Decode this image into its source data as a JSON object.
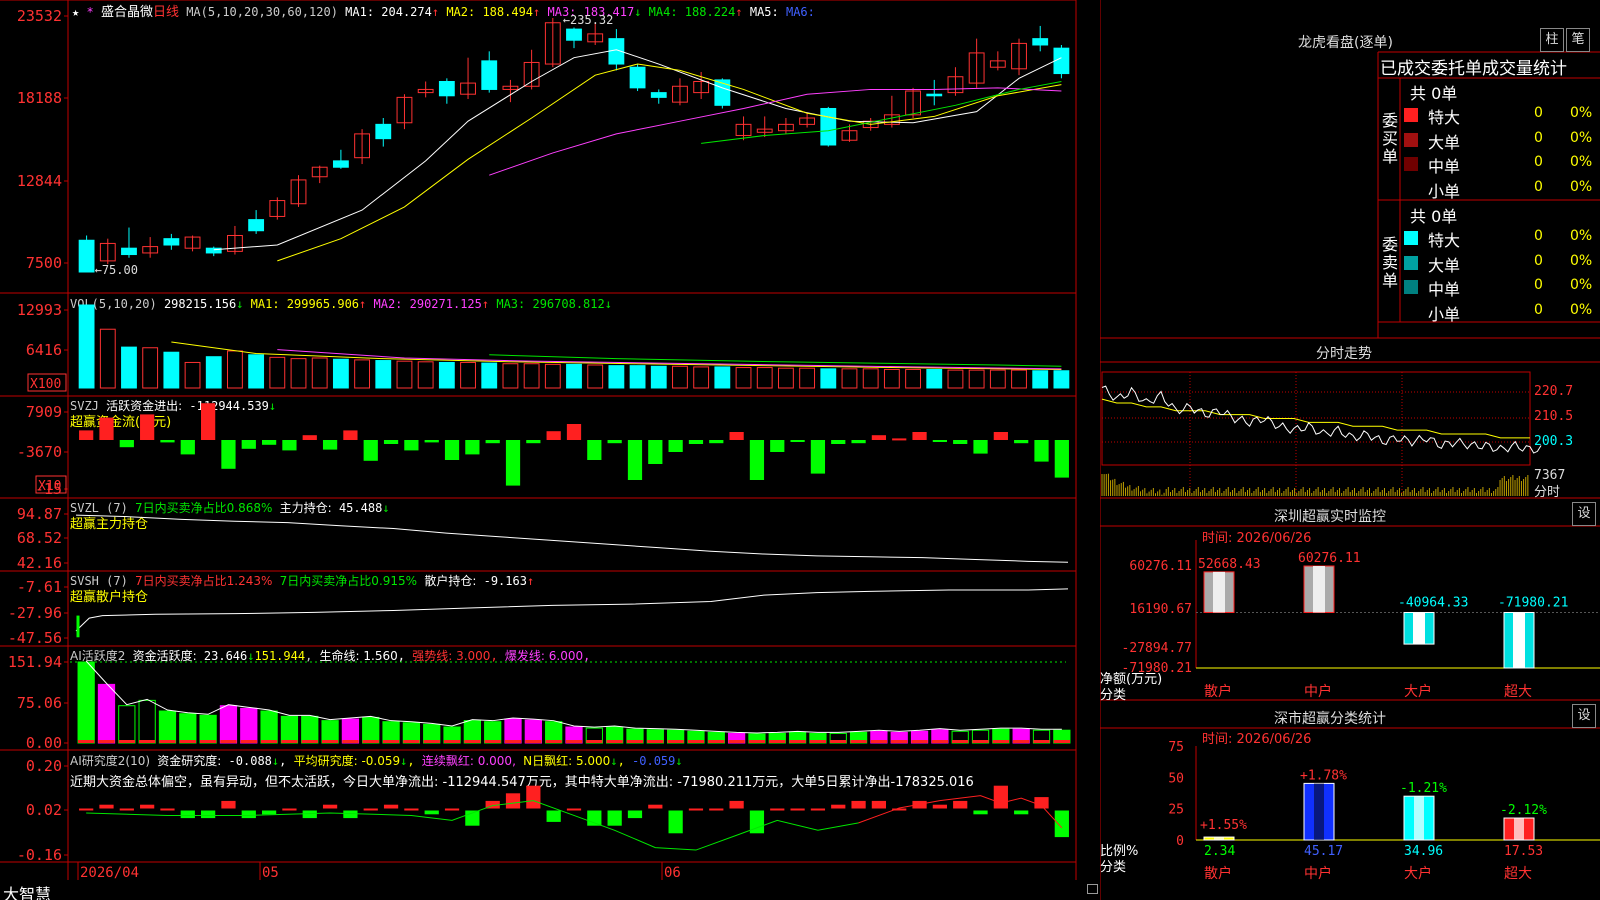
{
  "colors": {
    "up": "#ff3232",
    "down": "#00ffff",
    "grid": "#c00000",
    "ma1": "#ffffff",
    "ma2": "#ffff00",
    "ma3": "#ff40ff",
    "ma4": "#00e600",
    "ma5": "#4060ff",
    "vgreen": "#00ff00",
    "vmag": "#ff00ff"
  },
  "app": {
    "brand": "大智慧",
    "lock_icon": "lock-icon"
  },
  "kline": {
    "title_prefix": "★",
    "stock_name": "盛合晶微",
    "period": "日线",
    "ma_def": "MA(5,10,20,30,60,120)",
    "ma1": "MA1: 204.274",
    "ma1_arrow": "↑",
    "ma2": "MA2: 188.494",
    "ma2_arrow": "↑",
    "ma3": "MA3: 183.417",
    "ma3_arrow": "↓",
    "ma4": "MA4: 188.224",
    "ma4_arrow": "↑",
    "ma5": "MA5:",
    "ma6": "MA6:",
    "high_label": "235.32",
    "low_label": "75.00",
    "y_labels": [
      "23532",
      "18188",
      "12844",
      "7500"
    ]
  },
  "candles": [
    [
      95,
      75,
      98,
      75
    ],
    [
      82,
      93,
      96,
      80
    ],
    [
      90,
      86,
      103,
      84
    ],
    [
      87,
      91,
      97,
      84
    ],
    [
      96,
      92,
      99,
      89
    ],
    [
      90,
      97,
      98,
      88
    ],
    [
      90,
      87,
      91,
      85
    ],
    [
      88,
      98,
      104,
      86
    ],
    [
      108,
      101,
      114,
      99
    ],
    [
      110,
      120,
      122,
      108
    ],
    [
      118,
      133,
      136,
      116
    ],
    [
      135,
      141,
      142,
      131
    ],
    [
      145,
      141,
      152,
      140
    ],
    [
      147,
      162,
      165,
      143
    ],
    [
      168,
      159,
      172,
      154
    ],
    [
      169,
      185,
      187,
      165
    ],
    [
      188,
      190,
      195,
      185
    ],
    [
      195,
      186,
      197,
      181
    ],
    [
      187,
      194,
      210,
      184
    ],
    [
      208,
      190,
      214,
      188
    ],
    [
      190,
      192,
      196,
      182
    ],
    [
      192,
      207,
      215,
      190
    ],
    [
      206,
      232,
      235,
      204
    ],
    [
      228,
      221,
      229,
      216
    ],
    [
      220,
      225,
      232,
      218
    ],
    [
      222,
      206,
      228,
      202
    ],
    [
      204,
      191,
      206,
      189
    ],
    [
      188,
      185,
      190,
      181
    ],
    [
      182,
      192,
      197,
      180
    ],
    [
      188,
      195,
      201,
      184
    ],
    [
      196,
      180,
      197,
      178
    ],
    [
      161,
      168,
      173,
      158
    ],
    [
      163,
      165,
      173,
      160
    ],
    [
      164,
      168,
      172,
      162
    ],
    [
      168,
      172,
      175,
      166
    ],
    [
      178,
      155,
      179,
      154
    ],
    [
      158,
      164,
      168,
      157
    ],
    [
      166,
      170,
      172,
      164
    ],
    [
      168,
      174,
      186,
      166
    ],
    [
      174,
      189,
      191,
      172
    ],
    [
      187,
      186,
      196,
      180
    ],
    [
      188,
      198,
      204,
      186
    ],
    [
      194,
      213,
      222,
      191
    ],
    [
      204,
      208,
      214,
      202
    ],
    [
      203,
      219,
      222,
      199
    ],
    [
      222,
      218,
      230,
      214
    ],
    [
      216,
      200,
      218,
      197
    ]
  ],
  "ma_lines": {
    "white": [
      [
        6,
        89
      ],
      [
        9,
        92
      ],
      [
        13,
        114
      ],
      [
        16,
        145
      ],
      [
        18,
        170
      ],
      [
        21,
        195
      ],
      [
        23,
        210
      ],
      [
        25,
        215
      ],
      [
        27,
        206
      ],
      [
        30,
        191
      ],
      [
        33,
        178
      ],
      [
        36,
        170
      ],
      [
        39,
        169
      ],
      [
        42,
        176
      ],
      [
        44,
        197
      ],
      [
        46,
        210
      ]
    ],
    "yellow": [
      [
        9,
        82
      ],
      [
        12,
        96
      ],
      [
        15,
        116
      ],
      [
        18,
        146
      ],
      [
        21,
        172
      ],
      [
        24,
        199
      ],
      [
        26,
        206
      ],
      [
        28,
        202
      ],
      [
        31,
        190
      ],
      [
        34,
        175
      ],
      [
        37,
        168
      ],
      [
        40,
        173
      ],
      [
        43,
        186
      ],
      [
        46,
        193
      ]
    ],
    "magenta": [
      [
        19,
        136
      ],
      [
        22,
        150
      ],
      [
        25,
        162
      ],
      [
        28,
        170
      ],
      [
        31,
        178
      ],
      [
        34,
        187
      ],
      [
        37,
        190
      ],
      [
        40,
        190
      ],
      [
        43,
        191
      ],
      [
        46,
        189
      ]
    ],
    "green": [
      [
        29,
        156
      ],
      [
        32,
        161
      ],
      [
        35,
        164
      ],
      [
        38,
        172
      ],
      [
        41,
        180
      ],
      [
        44,
        190
      ],
      [
        46,
        195
      ]
    ]
  },
  "vol": {
    "title": "VOL(5,10,20)",
    "value": "298215.156",
    "value_arrow": "↓",
    "ma1": "MA1: 299965.906",
    "ma1_arrow": "↑",
    "ma2": "MA2: 290271.125",
    "ma2_arrow": "↑",
    "ma3": "MA3: 296708.812",
    "ma3_arrow": "↓",
    "y_labels": [
      "12993",
      "6416",
      "X100"
    ],
    "values": [
      12993,
      9200,
      6400,
      6300,
      5600,
      4000,
      4900,
      5800,
      5200,
      4800,
      4600,
      4700,
      4500,
      4400,
      4300,
      4200,
      4100,
      4000,
      4000,
      3900,
      3800,
      3800,
      3700,
      3700,
      3600,
      3500,
      3500,
      3400,
      3400,
      3300,
      3300,
      3200,
      3200,
      3100,
      3100,
      3000,
      3000,
      3000,
      2900,
      2900,
      2900,
      2800,
      2800,
      2800,
      2800,
      2700,
      2700
    ],
    "ma_yellow": [
      [
        4,
        7200
      ],
      [
        8,
        5400
      ],
      [
        14,
        4600
      ],
      [
        20,
        4100
      ],
      [
        26,
        3800
      ],
      [
        32,
        3500
      ],
      [
        38,
        3200
      ],
      [
        46,
        2900
      ]
    ],
    "ma_magenta": [
      [
        9,
        6000
      ],
      [
        15,
        4700
      ],
      [
        21,
        4200
      ],
      [
        27,
        3900
      ],
      [
        33,
        3600
      ],
      [
        39,
        3300
      ],
      [
        46,
        3000
      ]
    ],
    "ma_green": [
      [
        19,
        5200
      ],
      [
        25,
        4600
      ],
      [
        31,
        4200
      ],
      [
        37,
        3900
      ],
      [
        43,
        3600
      ],
      [
        46,
        3400
      ]
    ]
  },
  "svzj": {
    "title": "SVZJ",
    "label": "活跃资金进出:",
    "value": "-112944.539",
    "value_arrow": "↓",
    "subtitle": "超赢资金流(万元)",
    "y_labels": [
      "7909",
      "-3670",
      "-15",
      "X10"
    ],
    "values": [
      1200,
      2800,
      -900,
      3200,
      -300,
      -1800,
      4600,
      -3600,
      -1100,
      -600,
      -1300,
      600,
      -1200,
      1200,
      -2600,
      -500,
      -1300,
      -300,
      -2500,
      -1800,
      -400,
      -5700,
      -400,
      1100,
      2000,
      -2500,
      -400,
      -5000,
      -3000,
      -1500,
      -500,
      -400,
      1000,
      -5000,
      -1500,
      -200,
      -4200,
      -500,
      -400,
      600,
      200,
      1000,
      -200,
      -500,
      -1700,
      1000,
      -400,
      -2700,
      -4700
    ]
  },
  "svzl": {
    "title": "SVZL (7)",
    "d1": "7日内买卖净占比0.868%",
    "label": "主力持仓:",
    "value": "45.488",
    "value_arrow": "↓",
    "subtitle": "超赢主力持仓",
    "y_labels": [
      "94.87",
      "68.52",
      "42.16"
    ],
    "line": [
      [
        0,
        94.8
      ],
      [
        4,
        93
      ],
      [
        8,
        90
      ],
      [
        12,
        88
      ],
      [
        16,
        86.5
      ],
      [
        20,
        83
      ],
      [
        24,
        80
      ],
      [
        28,
        75
      ],
      [
        32,
        71
      ],
      [
        36,
        67
      ],
      [
        40,
        63
      ],
      [
        44,
        59
      ],
      [
        48,
        55
      ],
      [
        52,
        52
      ],
      [
        56,
        50
      ],
      [
        60,
        49
      ],
      [
        64,
        48
      ],
      [
        68,
        46
      ],
      [
        72,
        44
      ],
      [
        75,
        43
      ]
    ]
  },
  "svsh": {
    "title": "SVSH (7)",
    "d1": "7日内买卖净占比1.243%",
    "d2": "7日内买卖净占比0.915%",
    "label": "散户持仓:",
    "value": "-9.163",
    "value_arrow": "↑",
    "subtitle": "超赢散户持仓",
    "y_labels": [
      "-7.61",
      "-27.96",
      "-47.56"
    ],
    "line": [
      [
        0,
        -42
      ],
      [
        1,
        -32
      ],
      [
        2,
        -30
      ],
      [
        6,
        -29
      ],
      [
        12,
        -28.5
      ],
      [
        18,
        -27.5
      ],
      [
        24,
        -26
      ],
      [
        30,
        -24
      ],
      [
        36,
        -22
      ],
      [
        42,
        -21
      ],
      [
        48,
        -19
      ],
      [
        52,
        -14
      ],
      [
        56,
        -12
      ],
      [
        60,
        -11
      ],
      [
        66,
        -10
      ],
      [
        72,
        -10
      ],
      [
        75,
        -9.1
      ]
    ]
  },
  "ai_active": {
    "title": "AI活跃度2",
    "label": "资金活跃度:",
    "value": "23.646",
    "value_arrow": "↓",
    "v2": "151.944",
    "life": "生命线: 1.560",
    "strong": "强势线: 3.000",
    "burst": "爆发线: 6.000",
    "y_labels": [
      "151.94",
      "75.06",
      "0.00"
    ],
    "values": [
      [
        152,
        "g"
      ],
      [
        110,
        "m"
      ],
      [
        70,
        "o"
      ],
      [
        80,
        "o"
      ],
      [
        60,
        "g"
      ],
      [
        55,
        "g"
      ],
      [
        52,
        "g"
      ],
      [
        70,
        "m"
      ],
      [
        65,
        "m"
      ],
      [
        60,
        "g"
      ],
      [
        50,
        "g"
      ],
      [
        50,
        "g"
      ],
      [
        42,
        "g"
      ],
      [
        45,
        "m"
      ],
      [
        48,
        "g"
      ],
      [
        40,
        "g"
      ],
      [
        38,
        "g"
      ],
      [
        35,
        "g"
      ],
      [
        30,
        "g"
      ],
      [
        42,
        "g"
      ],
      [
        40,
        "g"
      ],
      [
        45,
        "m"
      ],
      [
        43,
        "m"
      ],
      [
        40,
        "g"
      ],
      [
        30,
        "m"
      ],
      [
        28,
        "o"
      ],
      [
        30,
        "g"
      ],
      [
        26,
        "g"
      ],
      [
        25,
        "g"
      ],
      [
        24,
        "g"
      ],
      [
        22,
        "g"
      ],
      [
        20,
        "g"
      ],
      [
        18,
        "m"
      ],
      [
        17,
        "g"
      ],
      [
        18,
        "g"
      ],
      [
        20,
        "g"
      ],
      [
        18,
        "g"
      ],
      [
        18,
        "o"
      ],
      [
        20,
        "g"
      ],
      [
        22,
        "m"
      ],
      [
        20,
        "m"
      ],
      [
        22,
        "m"
      ],
      [
        25,
        "m"
      ],
      [
        22,
        "o"
      ],
      [
        24,
        "o"
      ],
      [
        26,
        "g"
      ],
      [
        26,
        "m"
      ],
      [
        24,
        "o"
      ],
      [
        24,
        "g"
      ]
    ]
  },
  "ai_research": {
    "title": "AI研究度2(10)",
    "label": "资金研究度:",
    "value": "-0.088",
    "value_arrow": "↓",
    "avg": "平均研究度: -0.059",
    "avg_arrow": "↓",
    "cont": "连续飘红: 0.000,",
    "nday": "N日飘红: 5.000",
    "nday_arrow": "↓",
    "last": "-0.059",
    "last_arrow": "↓",
    "note": "近期大资金总体偏空，虽有异动，但不太活跃，今日大单净流出: -112944.547万元，其中特大单净流出: -71980.211万元，大单5日累计净出-178325.016",
    "y_labels": [
      "0.20",
      "0.02",
      "-0.16"
    ],
    "values": [
      0.0,
      0.01,
      0.0,
      0.01,
      0.0,
      -0.02,
      -0.02,
      0.02,
      -0.02,
      -0.01,
      0.0,
      -0.02,
      0.01,
      -0.02,
      0.0,
      0.01,
      0.0,
      -0.01,
      0.0,
      -0.04,
      0.02,
      0.04,
      0.06,
      -0.03,
      0.0,
      -0.04,
      -0.04,
      -0.02,
      0.01,
      -0.06,
      0.0,
      0.0,
      0.02,
      -0.06,
      0.0,
      0.0,
      0.0,
      0.01,
      0.02,
      0.02,
      0.0,
      0.02,
      0.01,
      0.02,
      -0.01,
      0.06,
      -0.01,
      0.03,
      -0.07
    ],
    "line": [
      [
        0,
        0.01
      ],
      [
        4,
        0.0
      ],
      [
        8,
        0.0
      ],
      [
        12,
        0.01
      ],
      [
        16,
        0.0
      ],
      [
        18,
        -0.02
      ],
      [
        20,
        0.04
      ],
      [
        22,
        0.06
      ],
      [
        24,
        0.0
      ],
      [
        26,
        -0.06
      ],
      [
        28,
        -0.13
      ],
      [
        30,
        -0.14
      ],
      [
        32,
        -0.08
      ],
      [
        34,
        -0.02
      ],
      [
        36,
        -0.06
      ],
      [
        38,
        -0.03
      ],
      [
        40,
        0.03
      ],
      [
        42,
        0.06
      ],
      [
        44,
        0.08
      ],
      [
        45,
        0.05
      ],
      [
        46,
        0.07
      ],
      [
        47,
        0.04
      ],
      [
        48,
        -0.05
      ]
    ]
  },
  "xaxis": {
    "labels": [
      "2026/04",
      "05",
      "06"
    ]
  },
  "lhb": {
    "title": "龙虎看盘(逐单)",
    "btn1": "柱",
    "btn2": "笔",
    "header": "已成交委托单成交量统计",
    "buy_total": "共 0单",
    "buy_side": "委买单",
    "sell_total": "共 0单",
    "sell_side": "委卖单",
    "buy_rows": [
      {
        "label": "特大",
        "color": "#ff2020",
        "qty": "0",
        "pct": "0%"
      },
      {
        "label": "大单",
        "color": "#a01010",
        "qty": "0",
        "pct": "0%"
      },
      {
        "label": "中单",
        "color": "#700000",
        "qty": "0",
        "pct": "0%"
      },
      {
        "label": "小单",
        "color": "",
        "qty": "0",
        "pct": "0%"
      }
    ],
    "sell_rows": [
      {
        "label": "特大",
        "color": "#00ffff",
        "qty": "0",
        "pct": "0%"
      },
      {
        "label": "大单",
        "color": "#00a0a0",
        "qty": "0",
        "pct": "0%"
      },
      {
        "label": "中单",
        "color": "#008080",
        "qty": "0",
        "pct": "0%"
      },
      {
        "label": "小单",
        "color": "",
        "qty": "0",
        "pct": "0%"
      }
    ]
  },
  "fenshi": {
    "title": "分时走势",
    "right_labels": [
      "220.7",
      "210.5",
      "200.3",
      "7367",
      "分时"
    ],
    "price": [
      206,
      203,
      205,
      202,
      204,
      200,
      201,
      199,
      200,
      198,
      197,
      198,
      196,
      195,
      196,
      194,
      195,
      193,
      194,
      192,
      193,
      192,
      193,
      191,
      192,
      191,
      191,
      190,
      191,
      190
    ],
    "avg": [
      203,
      202,
      202,
      201,
      201,
      200,
      200,
      200,
      199,
      199,
      199,
      198,
      198,
      198,
      197,
      197,
      197,
      196,
      196,
      196,
      195,
      195,
      195,
      194,
      194,
      194,
      194,
      193,
      193,
      193
    ]
  },
  "sz_monitor": {
    "title": "深圳超赢实时监控",
    "btn": "设",
    "time": "时间: 2026/06/26",
    "y_labels": [
      "60276.11",
      "16190.67",
      "-27894.77",
      "-71980.21"
    ],
    "unit1": "净额(万元)",
    "unit2": "分类",
    "categories": [
      "散户",
      "中户",
      "大户",
      "超大"
    ],
    "values": [
      52668.43,
      60276.11,
      -40964.33,
      -71980.21
    ],
    "value_labels": [
      "52668.43",
      "60276.11",
      "-40964.33",
      "-71980.21"
    ]
  },
  "sz_stats": {
    "title": "深市超赢分类统计",
    "btn": "设",
    "time": "时间: 2026/06/26",
    "y_labels": [
      "75",
      "50",
      "25",
      "0"
    ],
    "unit1": "比例%",
    "unit2": "分类",
    "categories": [
      "散户",
      "中户",
      "大户",
      "超大"
    ],
    "values": [
      2.34,
      45.17,
      34.96,
      17.53
    ],
    "value_labels": [
      "2.34",
      "45.17",
      "34.96",
      "17.53"
    ],
    "changes": [
      "+1.55%",
      "+1.78%",
      "-1.21%",
      "-2.12%"
    ],
    "bar_colors": [
      "#ffff00",
      "#1030ff",
      "#00ffff",
      "#ff2020"
    ]
  }
}
